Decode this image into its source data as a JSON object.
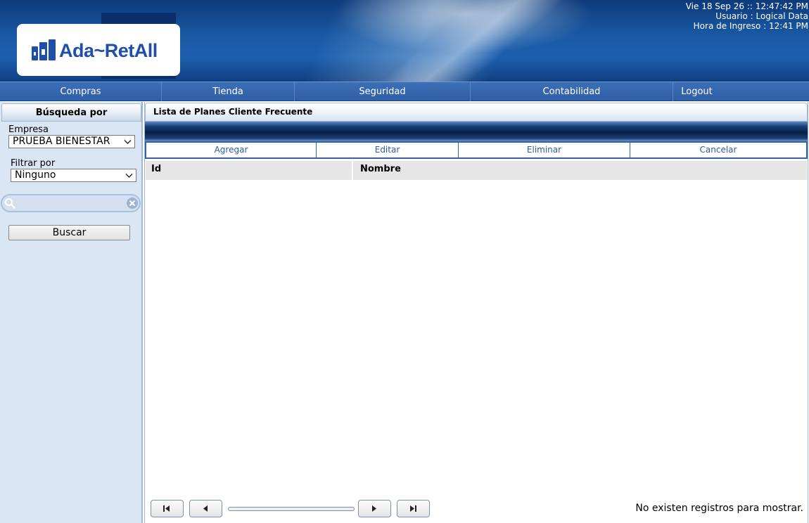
{
  "header": {
    "logo_text": "Ada~RetAll",
    "date_line": "Vie 18 Sep 26 :: 12:47:42 PM",
    "user_line": "Usuario : Logical Data",
    "login_line": "Hora de Ingreso : 12:41 PM"
  },
  "nav": {
    "items": [
      {
        "label": "Compras"
      },
      {
        "label": "Tienda"
      },
      {
        "label": "Seguridad"
      },
      {
        "label": "Contabilidad"
      },
      {
        "label": "Logout"
      }
    ]
  },
  "sidebar": {
    "title": "Búsqueda por",
    "empresa_label": "Empresa",
    "empresa_value": "PRUEBA BIENESTAR",
    "filtrar_label": "Filtrar por",
    "filtrar_value": "Ninguno",
    "search_value": "",
    "buscar_label": "Buscar"
  },
  "main": {
    "title": "Lista de Planes Cliente Frecuente",
    "actions": [
      {
        "label": "Agregar"
      },
      {
        "label": "Editar"
      },
      {
        "label": "Eliminar"
      },
      {
        "label": "Cancelar"
      }
    ],
    "columns": [
      "Id",
      "Nombre"
    ],
    "rows": [],
    "empty_message": "No existen registros para mostrar."
  },
  "colors": {
    "header_blue": "#1c5fae",
    "nav_blue": "#3c6fb6",
    "sidebar_bg": "#dbe6f4",
    "action_text": "#2c5b9e",
    "logo_blue": "#1f4fa8"
  },
  "icons": [
    "logo-buildings-icon",
    "chevron-down-icon",
    "search-icon",
    "clear-icon",
    "first-page-icon",
    "prev-page-icon",
    "next-page-icon",
    "last-page-icon"
  ]
}
